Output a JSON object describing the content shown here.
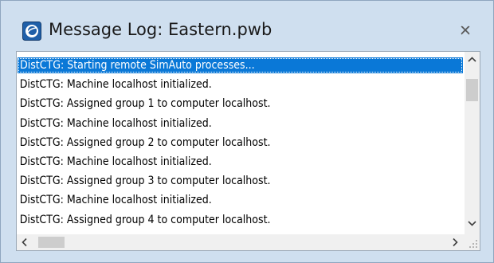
{
  "window": {
    "title": "Message Log: Eastern.pwb",
    "icon": "app-icon",
    "close_icon": "close-icon"
  },
  "messages": [
    "DistCTG: Starting remote SimAuto processes...",
    "DistCTG: Machine localhost initialized.",
    "DistCTG: Assigned group 1 to computer localhost.",
    "DistCTG: Machine localhost initialized.",
    "DistCTG: Assigned group 2 to computer localhost.",
    "DistCTG: Machine localhost initialized.",
    "DistCTG: Assigned group 3 to computer localhost.",
    "DistCTG: Machine localhost initialized.",
    "DistCTG: Assigned group 4 to computer localhost."
  ],
  "selected_index": 0,
  "colors": {
    "selection": "#0a78d7",
    "frame": "#cfdfef",
    "scrollbar": "#f0f0f0"
  }
}
